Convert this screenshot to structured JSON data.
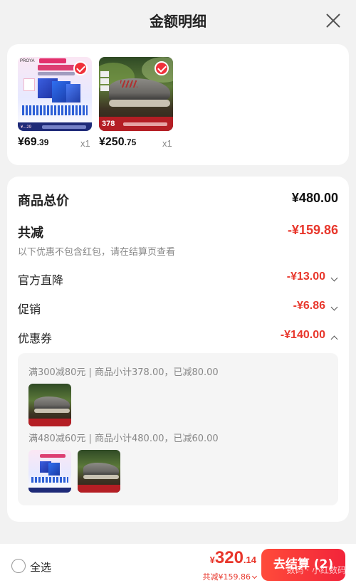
{
  "header": {
    "title": "金额明细"
  },
  "products": [
    {
      "price_int": "¥69",
      "price_dec": ".39",
      "qty": "x1",
      "image_text": {
        "brand": "PROYA",
        "price": "¥...29"
      }
    },
    {
      "price_int": "¥250",
      "price_dec": ".75",
      "qty": "x1",
      "image_text": {
        "price": "378"
      }
    }
  ],
  "breakdown": {
    "total_label": "商品总价",
    "total_value": "¥480.00",
    "reduction_label": "共减",
    "reduction_value": "-¥159.86",
    "note": "以下优惠不包含红包，请在结算页查看",
    "items": [
      {
        "label": "官方直降",
        "value": "-¥13.00",
        "expanded": false
      },
      {
        "label": "促销",
        "value": "-¥6.86",
        "expanded": false
      },
      {
        "label": "优惠券",
        "value": "-¥140.00",
        "expanded": true
      }
    ],
    "coupons": [
      {
        "text": "满300减80元 | 商品小计378.00，已减80.00"
      },
      {
        "text": "满480减60元 | 商品小计480.00，已减60.00"
      }
    ]
  },
  "bottom": {
    "select_all": "全选",
    "total_cur": "¥",
    "total_int": "320",
    "total_dec": ".14",
    "saved": "共减¥159.86",
    "checkout": "去结算 (2)",
    "watermark": "数码 · 小红数码"
  },
  "colors": {
    "accent": "#e8372c",
    "checkout_start": "#ff4b3a",
    "checkout_end": "#f2243a"
  }
}
